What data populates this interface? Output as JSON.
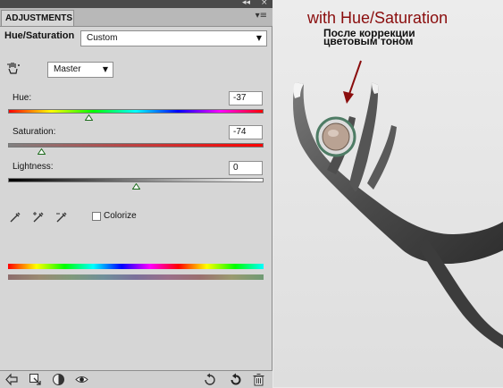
{
  "panel": {
    "tab_label": "ADJUSTMENTS",
    "title": "Hue/Saturation",
    "preset": "Custom",
    "channel": "Master",
    "hue": {
      "label": "Hue:",
      "value": "-37",
      "thumb_fraction": 0.316
    },
    "saturation": {
      "label": "Saturation:",
      "value": "-74",
      "thumb_fraction": 0.13
    },
    "lightness": {
      "label": "Lightness:",
      "value": "0",
      "thumb_fraction": 0.5
    },
    "colorize": {
      "label": "Colorize",
      "checked": false
    }
  },
  "annotation": {
    "heading": "with Hue/Saturation",
    "caption_line1": "После коррекции",
    "caption_line2": "цветовым тоном",
    "heading_color": "#8a0d0d"
  },
  "icons": [
    "collapse-icon",
    "panel-menu-icon",
    "hand-adjust-icon",
    "eyedropper-icon",
    "eyedropper-plus-icon",
    "eyedropper-minus-icon",
    "back-arrow-icon",
    "clip-to-layer-icon",
    "mask-icon",
    "eye-icon",
    "view-previous-icon",
    "reset-icon",
    "trash-icon"
  ]
}
